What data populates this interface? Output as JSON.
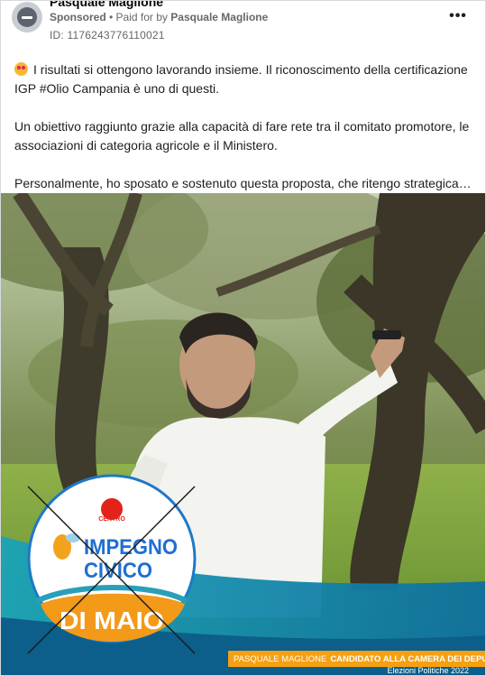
{
  "post": {
    "page_name": "Pasquale Maglione",
    "sponsored": "Sponsored",
    "separator": " • ",
    "paid_for": "Paid for by",
    "payer": "Pasquale Maglione",
    "ad_id": "ID: 1176243776110021",
    "more_icon": "•••",
    "paragraphs": [
      "I risultati si ottengono lavorando insieme. Il riconoscimento della certificazione IGP #Olio Campania è uno di questi.",
      "Un obiettivo raggiunto grazie alla capacità di fare rete tra il comitato promotore, le associazioni di categoria agricole e il Ministero.",
      "Personalmente, ho sposato e sostenuto questa proposta, che ritengo strategica…"
    ]
  },
  "creative": {
    "logo_party_small": "CENTRO",
    "logo_line1": "IMPEGNO",
    "logo_line2": "CIVICO",
    "logo_line3": "DI MAIO",
    "banner_name": "PASQUALE MAGLIONE",
    "banner_role": "CANDIDATO ALLA CAMERA DEI DEPUTATI",
    "election": "Elezioni Politiche 2022"
  },
  "colors": {
    "accent_orange": "#f5a012",
    "logo_blue": "#1f6fd1",
    "logo_teal": "#2a9fb8"
  }
}
